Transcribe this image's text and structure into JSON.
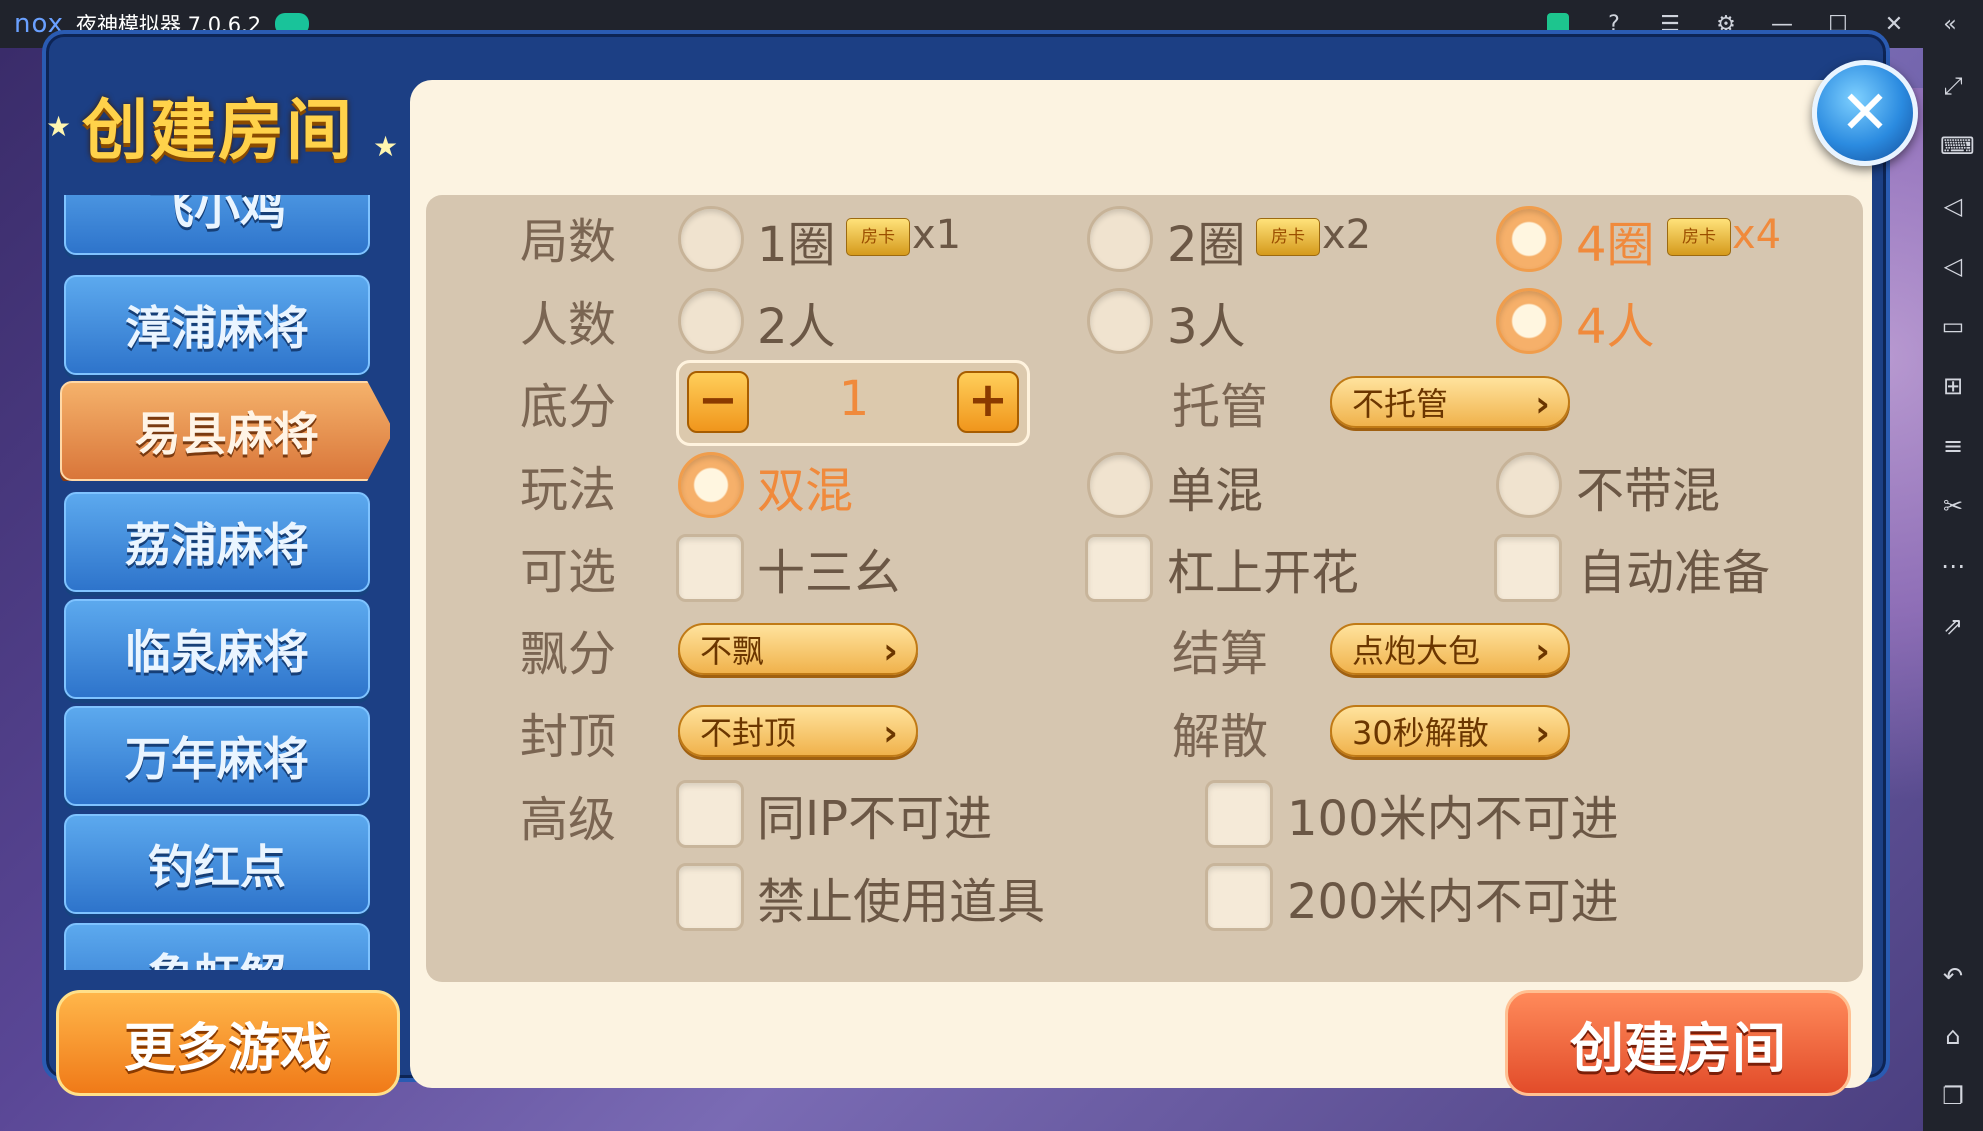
{
  "titlebar": {
    "brand": "nox",
    "title": "夜神模拟器 7.0.6.2"
  },
  "dialog": {
    "title": "创建房间",
    "game_list": [
      "飞小鸡",
      "漳浦麻将",
      "易县麻将",
      "荔浦麻将",
      "临泉麻将",
      "万年麻将",
      "钓红点",
      "象虹解"
    ],
    "selected_game": "易县麻将",
    "more_games_label": "更多游戏",
    "create_label": "创建房间",
    "close_symbol": "✕"
  },
  "options": {
    "rounds": {
      "label": "局数",
      "chip": "房卡",
      "choices": [
        {
          "text": "1圈",
          "mult": "x1",
          "selected": false
        },
        {
          "text": "2圈",
          "mult": "x2",
          "selected": false
        },
        {
          "text": "4圈",
          "mult": "x4",
          "selected": true
        }
      ]
    },
    "players": {
      "label": "人数",
      "choices": [
        {
          "text": "2人",
          "selected": false
        },
        {
          "text": "3人",
          "selected": false
        },
        {
          "text": "4人",
          "selected": true
        }
      ]
    },
    "base_score": {
      "label": "底分",
      "value": "1",
      "minus": "−",
      "plus": "+"
    },
    "trustee": {
      "label": "托管",
      "value": "不托管"
    },
    "play": {
      "label": "玩法",
      "choices": [
        {
          "text": "双混",
          "selected": true
        },
        {
          "text": "单混",
          "selected": false
        },
        {
          "text": "不带混",
          "selected": false
        }
      ]
    },
    "optional": {
      "label": "可选",
      "choices": [
        "十三幺",
        "杠上开花",
        "自动准备"
      ]
    },
    "float": {
      "label": "飘分",
      "value": "不飘"
    },
    "settle": {
      "label": "结算",
      "value": "点炮大包"
    },
    "cap": {
      "label": "封顶",
      "value": "不封顶"
    },
    "dismiss": {
      "label": "解散",
      "value": "30秒解散"
    },
    "advanced": {
      "label": "高级",
      "choices": [
        "同IP不可进",
        "100米内不可进",
        "禁止使用道具",
        "200米内不可进"
      ]
    }
  }
}
